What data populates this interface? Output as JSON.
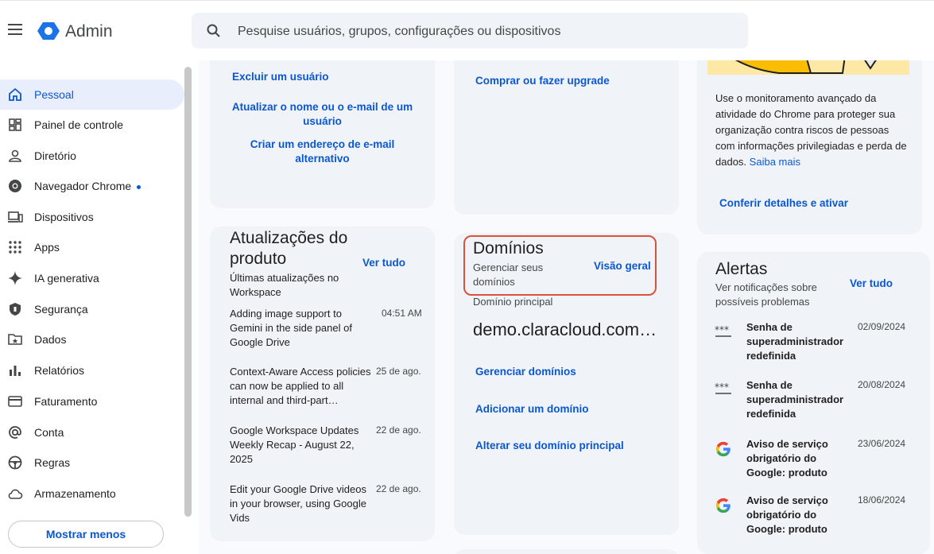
{
  "header": {
    "brand": "Admin",
    "search_placeholder": "Pesquise usuários, grupos, configurações ou dispositivos"
  },
  "sidebar": {
    "items": [
      {
        "label": "Pessoal",
        "icon": "home-icon",
        "active": true
      },
      {
        "label": "Painel de controle",
        "icon": "dashboard-icon"
      },
      {
        "label": "Diretório",
        "icon": "person-icon"
      },
      {
        "label": "Navegador Chrome",
        "icon": "chrome-icon",
        "dot": true
      },
      {
        "label": "Dispositivos",
        "icon": "devices-icon"
      },
      {
        "label": "Apps",
        "icon": "apps-grid-icon"
      },
      {
        "label": "IA generativa",
        "icon": "sparkle-icon"
      },
      {
        "label": "Segurança",
        "icon": "shield-icon"
      },
      {
        "label": "Dados",
        "icon": "folder-star-icon"
      },
      {
        "label": "Relatórios",
        "icon": "bar-chart-icon"
      },
      {
        "label": "Faturamento",
        "icon": "credit-card-icon"
      },
      {
        "label": "Conta",
        "icon": "at-sign-icon"
      },
      {
        "label": "Regras",
        "icon": "steering-wheel-icon"
      },
      {
        "label": "Armazenamento",
        "icon": "cloud-icon"
      }
    ],
    "show_less": "Mostrar menos"
  },
  "user_card": {
    "links": [
      "Excluir um usuário",
      "Atualizar o nome ou o e-mail de um usuário",
      "Criar um endereço de e-mail alternativo"
    ]
  },
  "billing_card": {
    "link": "Comprar ou fazer upgrade"
  },
  "chrome_card": {
    "text": "Use o monitoramento avançado da atividade do Chrome para proteger sua organização contra riscos de pessoas com informações privilegiadas e perda de dados.",
    "learn_more": "Saiba mais",
    "action": "Conferir detalhes e ativar"
  },
  "updates_card": {
    "title": "Atualizações do produto",
    "view_all": "Ver tudo",
    "subtitle": "Últimas atualizações no Workspace",
    "items": [
      {
        "title": "Adding image support to Gemini in the side panel of Google Drive",
        "date": "04:51 AM"
      },
      {
        "title": "Context-Aware Access policies can now be applied to all internal and third-part…",
        "date": "25 de ago."
      },
      {
        "title": "Google Workspace Updates Weekly Recap - August 22, 2025",
        "date": "22 de ago."
      },
      {
        "title": "Edit your Google Drive videos in your browser, using Google Vids",
        "date": "22 de ago."
      }
    ]
  },
  "domains_card": {
    "title": "Domínios",
    "subtitle": "Gerenciar seus domínios",
    "overview": "Visão geral",
    "primary_label": "Domínio principal",
    "primary_domain": "demo.claracloud.com…",
    "links": [
      "Gerenciar domínios",
      "Adicionar um domínio",
      "Alterar seu domínio principal"
    ]
  },
  "alerts_card": {
    "title": "Alertas",
    "subtitle": "Ver notificações sobre possíveis problemas",
    "view_all": "Ver tudo",
    "items": [
      {
        "title": "Senha de superadministrador redefinida",
        "date": "02/09/2024",
        "icon": "password-icon"
      },
      {
        "title": "Senha de superadministrador redefinida",
        "date": "20/08/2024",
        "icon": "password-icon"
      },
      {
        "title": "Aviso de serviço obrigatório do Google: produto",
        "date": "23/06/2024",
        "icon": "google-g-icon"
      },
      {
        "title": "Aviso de serviço obrigatório do Google: produto",
        "date": "18/06/2024",
        "icon": "google-g-icon"
      }
    ]
  }
}
